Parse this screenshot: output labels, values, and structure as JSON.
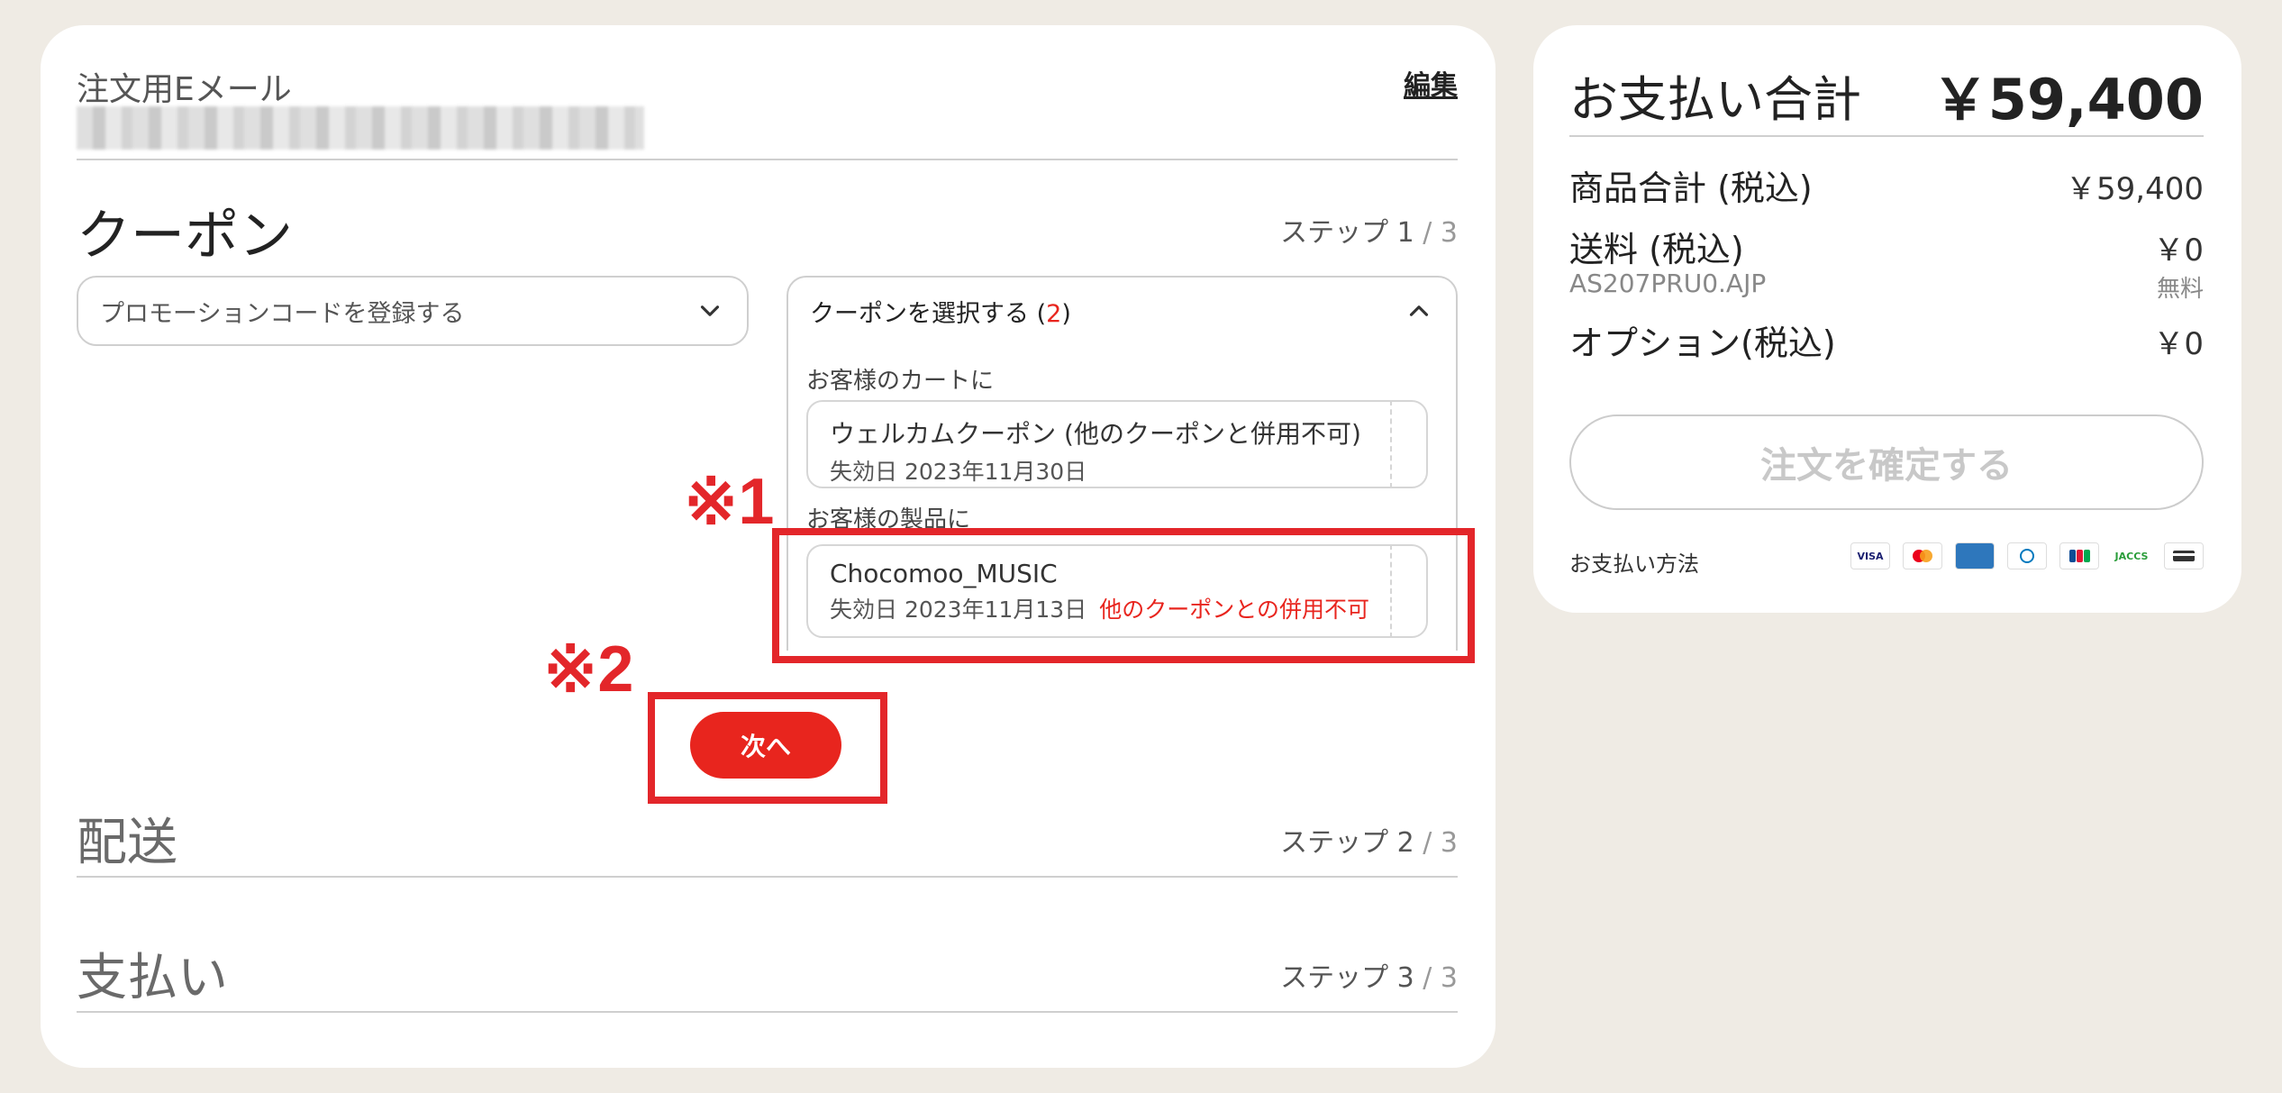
{
  "email": {
    "label": "注文用Eメール",
    "edit": "編集"
  },
  "coupon_section": {
    "title": "クーポン",
    "step": "ステップ 1",
    "step_of": " / 3",
    "promo_placeholder": "プロモーションコードを登録する",
    "select_label": "クーポンを選択する (",
    "select_count": "2",
    "select_close": ")",
    "groups": [
      {
        "label": "お客様のカートに",
        "coupon": {
          "name": "ウェルカムクーポン (他のクーポンと併用不可)",
          "expiry": "失効日 2023年11月30日",
          "note": ""
        }
      },
      {
        "label": "お客様の製品に",
        "coupon": {
          "name": "Chocomoo_MUSIC",
          "expiry": "失効日 2023年11月13日",
          "note": "他のクーポンとの併用不可"
        }
      }
    ],
    "next": "次へ"
  },
  "annotations": {
    "a1": "※1",
    "a2": "※2"
  },
  "shipping_section": {
    "title": "配送",
    "step": "ステップ 2",
    "step_of": " / 3"
  },
  "payment_section": {
    "title": "支払い",
    "step": "ステップ 3",
    "step_of": " / 3"
  },
  "summary": {
    "title": "お支払い合計",
    "total": "￥59,400",
    "rows": {
      "subtotal_label": "商品合計 (税込)",
      "subtotal_value": "￥59,400",
      "shipping_label": "送料 (税込)",
      "shipping_value": "￥0",
      "shipping_code": "AS207PRU0.AJP",
      "shipping_note": "無料",
      "option_label": "オプション(税込)",
      "option_value": "￥0"
    },
    "confirm": "注文を確定する",
    "pay_method_label": "お支払い方法",
    "pay_icons": [
      "VISA",
      "MC",
      "AMEX",
      "DINERS",
      "JCB",
      "JACCS",
      "CARD"
    ],
    "pay_icon_texts": [
      "VISA",
      "",
      "",
      "",
      "",
      "JACCS",
      ""
    ]
  },
  "colors": {
    "accent": "#e8251e",
    "background": "#efebe4"
  }
}
